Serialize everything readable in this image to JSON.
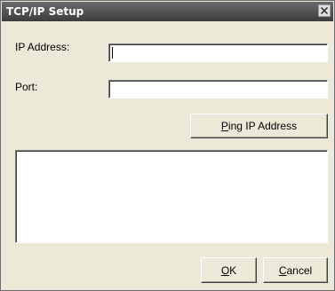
{
  "window": {
    "title": "TCP/IP Setup",
    "close_icon": "close-icon"
  },
  "form": {
    "ip_label": "IP Address:",
    "ip_value": "",
    "port_label": "Port:",
    "port_value": ""
  },
  "buttons": {
    "ping": {
      "mnemonic": "P",
      "rest": "ing IP Address"
    },
    "ok": {
      "mnemonic": "O",
      "rest": "K"
    },
    "cancel": {
      "mnemonic": "C",
      "rest": "ancel"
    }
  },
  "output": {
    "text": ""
  }
}
